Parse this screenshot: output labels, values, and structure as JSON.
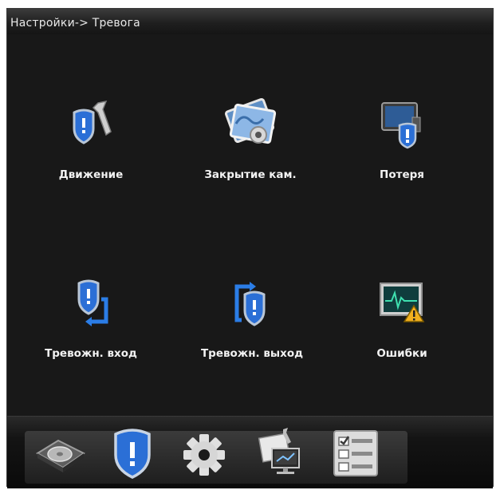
{
  "window": {
    "breadcrumb": "Настройки-> Тревога"
  },
  "tiles": [
    {
      "label": "Движение",
      "icon": "shield-wrench-icon"
    },
    {
      "label": "Закрытие кам.",
      "icon": "camera-cover-icon"
    },
    {
      "label": "Потеря",
      "icon": "video-loss-icon"
    },
    {
      "label": "Тревожн. вход",
      "icon": "alarm-input-icon"
    },
    {
      "label": "Тревожн. выход",
      "icon": "alarm-output-icon"
    },
    {
      "label": "Ошибки",
      "icon": "error-monitor-icon"
    }
  ],
  "dock": [
    {
      "icon": "hdd-icon",
      "active": false
    },
    {
      "icon": "shield-icon",
      "active": true
    },
    {
      "icon": "gear-icon",
      "active": false
    },
    {
      "icon": "network-tools-icon",
      "active": false
    },
    {
      "icon": "checklist-icon",
      "active": false
    }
  ],
  "colors": {
    "background": "#181818",
    "shield_blue": "#2b6fd6",
    "accent_glow": "#468cff"
  }
}
